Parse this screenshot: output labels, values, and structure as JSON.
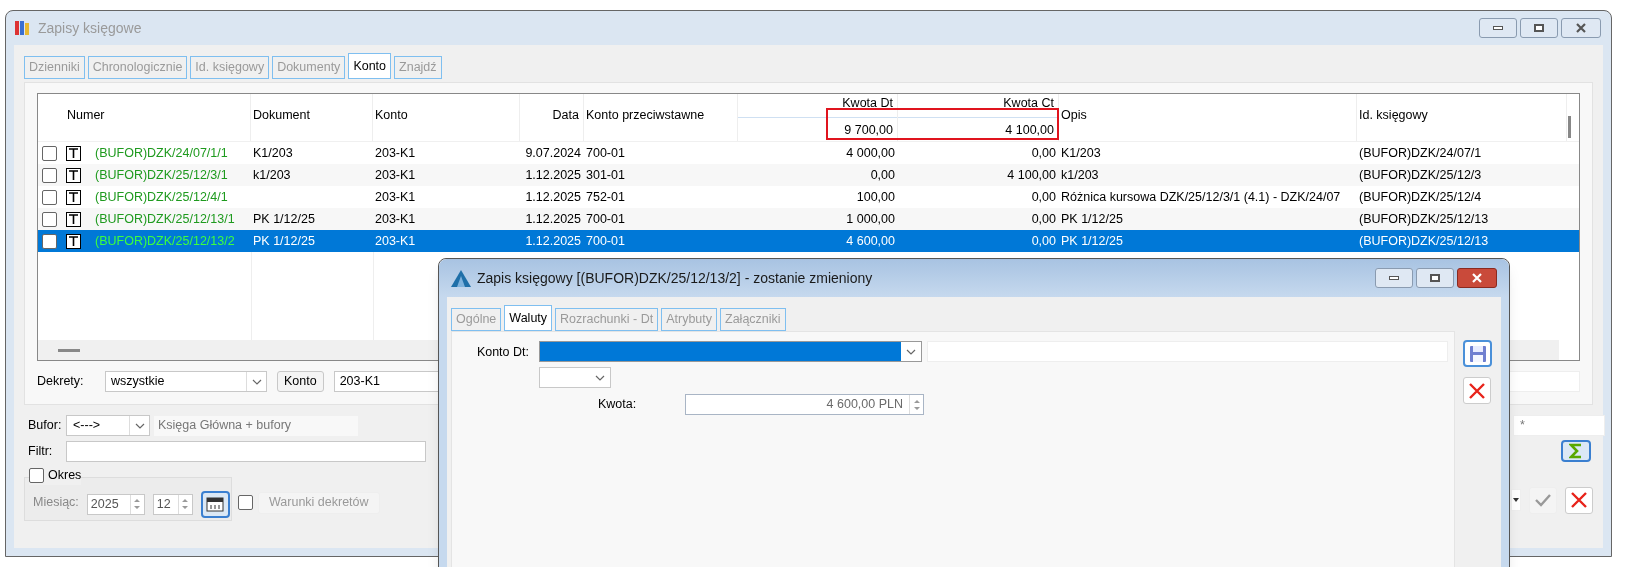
{
  "window": {
    "title": "Zapisy księgowe"
  },
  "tabs": [
    {
      "label": "Dzienniki",
      "selected": false
    },
    {
      "label": "Chronologicznie",
      "selected": false
    },
    {
      "label": "Id. księgowy",
      "selected": false
    },
    {
      "label": "Dokumenty",
      "selected": false
    },
    {
      "label": "Konto",
      "selected": true
    },
    {
      "label": "Znajdź",
      "selected": false
    }
  ],
  "table": {
    "columns": [
      "Numer",
      "Dokument",
      "Konto",
      "Data",
      "Konto przeciwstawne",
      "Kwota Dt",
      "Kwota Ct",
      "Opis",
      "Id. księgowy"
    ],
    "totals": {
      "debit": "9 700,00",
      "credit": "4 100,00"
    },
    "rows": [
      {
        "checked": false,
        "selected": false,
        "cells": [
          "(BUFOR)DZK/24/07/1/1",
          "K1/203",
          "203-K1",
          "9.07.2024",
          "700-01",
          "4 000,00",
          "0,00",
          "K1/203",
          "(BUFOR)DZK/24/07/1"
        ]
      },
      {
        "checked": false,
        "selected": false,
        "cells": [
          "(BUFOR)DZK/25/12/3/1",
          "k1/203",
          "203-K1",
          "1.12.2025",
          "301-01",
          "0,00",
          "4 100,00",
          "k1/203",
          "(BUFOR)DZK/25/12/3"
        ]
      },
      {
        "checked": false,
        "selected": false,
        "cells": [
          "(BUFOR)DZK/25/12/4/1",
          "",
          "203-K1",
          "1.12.2025",
          "752-01",
          "100,00",
          "0,00",
          "Różnica kursowa DZK/25/12/3/1 (4.1) - DZK/24/07",
          "(BUFOR)DZK/25/12/4"
        ]
      },
      {
        "checked": false,
        "selected": false,
        "cells": [
          "(BUFOR)DZK/25/12/13/1",
          "PK 1/12/25",
          "203-K1",
          "1.12.2025",
          "700-01",
          "1 000,00",
          "0,00",
          "PK 1/12/25",
          "(BUFOR)DZK/25/12/13"
        ]
      },
      {
        "checked": false,
        "selected": true,
        "cells": [
          "(BUFOR)DZK/25/12/13/2",
          "PK 1/12/25",
          "203-K1",
          "1.12.2025",
          "700-01",
          "4 600,00",
          "0,00",
          "PK 1/12/25",
          "(BUFOR)DZK/25/12/13"
        ]
      }
    ]
  },
  "filters": {
    "dekrety_label": "Dekrety:",
    "dekrety_value": "wszystkie",
    "konto_button": "Konto",
    "konto_value": "203-K1",
    "bufor_label": "Bufor:",
    "bufor_value": "<--->",
    "bufor_description": "Księga Główna + bufory",
    "filtr_label": "Filtr:",
    "okres": {
      "label": "Okres",
      "checked": false
    },
    "miesiac_label": "Miesiąc:",
    "year": "2025",
    "month": "12",
    "warunki": {
      "label": "Warunki dekretów",
      "checked": false
    },
    "mask_value": "*"
  },
  "dialog": {
    "title": "Zapis księgowy [(BUFOR)DZK/25/12/13/2] - zostanie zmieniony",
    "tabs": [
      {
        "label": "Ogólne",
        "selected": false
      },
      {
        "label": "Waluty",
        "selected": true
      },
      {
        "label": "Rozrachunki - Dt",
        "selected": false
      },
      {
        "label": "Atrybuty",
        "selected": false
      },
      {
        "label": "Załączniki",
        "selected": false
      }
    ],
    "konto_dt_label": "Konto Dt:",
    "kwota_label": "Kwota:",
    "kwota_value": "4 600,00 PLN"
  }
}
